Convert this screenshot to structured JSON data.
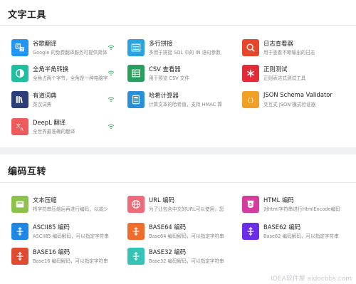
{
  "sections": {
    "text_tools": {
      "title": "文字工具",
      "tools": [
        {
          "name": "谷歌翻译",
          "desc": "Google 的免费翻译服务可提供简体",
          "color": "#2196f3",
          "icon": "translate-icon",
          "online": true
        },
        {
          "name": "多行拼接",
          "desc": "多用于拼接 SQL 中的 IN 语句参数",
          "color": "#29a3e3",
          "icon": "rows-join-icon",
          "online": false
        },
        {
          "name": "日志查看器",
          "desc": "用于查看不断输出的日志",
          "color": "#e8462a",
          "icon": "log-search-icon",
          "online": false
        },
        {
          "name": "全角半角转换",
          "desc": "全角占两个字节，全角是一种电脑字",
          "color": "#1fbfa0",
          "icon": "half-circle-icon",
          "online": true
        },
        {
          "name": "CSV 查看器",
          "desc": "用于预览 CSV 文件",
          "color": "#2a9f5d",
          "icon": "csv-table-icon",
          "online": false
        },
        {
          "name": "正则测试",
          "desc": "正则表达式测试工具",
          "color": "#e32b38",
          "icon": "asterisk-icon",
          "online": false
        },
        {
          "name": "有道词典",
          "desc": "英汉词典",
          "color": "#2c3e7a",
          "icon": "books-icon",
          "online": true
        },
        {
          "name": "哈希计算器",
          "desc": "计算文本的哈希值，支持 HMAC 算",
          "color": "#2a8fd6",
          "icon": "calculator-icon",
          "online": false
        },
        {
          "name": "JSON Schema Validator",
          "desc": "交互式 JSON 模式验证器",
          "color": "#f0a125",
          "icon": "braces-icon",
          "online": false
        },
        {
          "name": "DeepL 翻译",
          "desc": "全世界最准确的翻译",
          "color": "#ef5a5a",
          "icon": "language-icon",
          "online": true
        }
      ]
    },
    "encoding": {
      "title": "编码互转",
      "tools": [
        {
          "name": "文本压缩",
          "desc": "将字符串压缩后再进行编码，以减少",
          "color": "#8bc34a",
          "icon": "compress-icon"
        },
        {
          "name": "URL 编码",
          "desc": "为了让包含中文的URL可以使用，您",
          "color": "#f06b7a",
          "icon": "globe-icon"
        },
        {
          "name": "HTML 编码",
          "desc": "对html字符串进行HtmlEncode编码",
          "color": "#d63c9e",
          "icon": "html5-icon"
        },
        {
          "name": "ASCII85 编码",
          "desc": "ASCII85 编码解码，可以指定字符串",
          "color": "#1e88e5",
          "icon": "transform-icon"
        },
        {
          "name": "BASE64 编码",
          "desc": "Base64 编码解码，可以指定字符串",
          "color": "#ef6c2a",
          "icon": "transform-icon"
        },
        {
          "name": "BASE62 编码",
          "desc": "Base62 编码解码，可以指定字符串",
          "color": "#6a2ee6",
          "icon": "transform-icon"
        },
        {
          "name": "BASE16 编码",
          "desc": "Base16 编码解码，可以指定字符串",
          "color": "#e04a2e",
          "icon": "transform-icon"
        },
        {
          "name": "BASE32 编码",
          "desc": "Base32 编码解码，可以指定字符串",
          "color": "#36c2b4",
          "icon": "transform-icon"
        }
      ]
    }
  },
  "watermark": "IDEA软件屋 aidocbbs.com"
}
